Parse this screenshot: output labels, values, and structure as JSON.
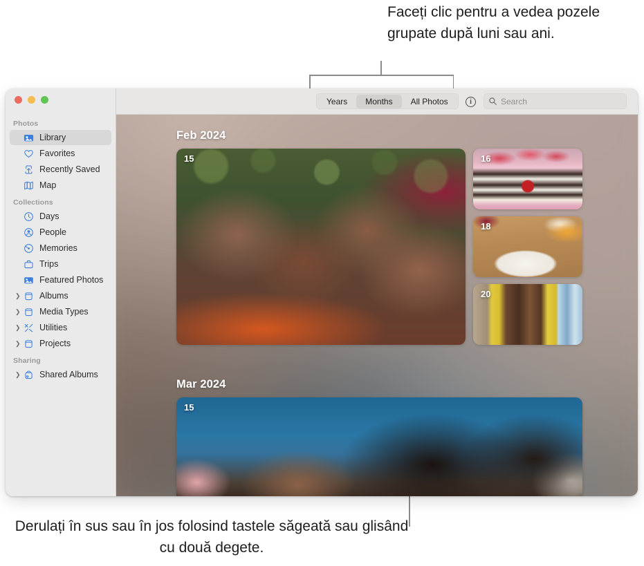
{
  "annotations": {
    "top_callout": "Faceți clic pentru a vedea pozele grupate după luni sau ani.",
    "bottom_callout": "Derulați în sus sau în jos folosind tastele săgeată sau glisând cu două degete."
  },
  "window": {
    "traffic_lights": [
      "close",
      "minimize",
      "zoom"
    ]
  },
  "sidebar": {
    "sections": [
      {
        "header": "Photos",
        "items": [
          {
            "label": "Library",
            "icon": "photos-library-icon",
            "selected": true,
            "disclosure": false
          },
          {
            "label": "Favorites",
            "icon": "heart-icon",
            "selected": false,
            "disclosure": false
          },
          {
            "label": "Recently Saved",
            "icon": "recently-saved-icon",
            "selected": false,
            "disclosure": false
          },
          {
            "label": "Map",
            "icon": "map-icon",
            "selected": false,
            "disclosure": false
          }
        ]
      },
      {
        "header": "Collections",
        "items": [
          {
            "label": "Days",
            "icon": "clock-icon",
            "selected": false,
            "disclosure": false
          },
          {
            "label": "People",
            "icon": "person-circle-icon",
            "selected": false,
            "disclosure": false
          },
          {
            "label": "Memories",
            "icon": "memories-icon",
            "selected": false,
            "disclosure": false
          },
          {
            "label": "Trips",
            "icon": "suitcase-icon",
            "selected": false,
            "disclosure": false
          },
          {
            "label": "Featured Photos",
            "icon": "featured-photo-icon",
            "selected": false,
            "disclosure": false
          },
          {
            "label": "Albums",
            "icon": "album-box-icon",
            "selected": false,
            "disclosure": true
          },
          {
            "label": "Media Types",
            "icon": "album-box-icon",
            "selected": false,
            "disclosure": true
          },
          {
            "label": "Utilities",
            "icon": "tools-icon",
            "selected": false,
            "disclosure": true
          },
          {
            "label": "Projects",
            "icon": "album-box-icon",
            "selected": false,
            "disclosure": true
          }
        ]
      },
      {
        "header": "Sharing",
        "items": [
          {
            "label": "Shared Albums",
            "icon": "shared-album-icon",
            "selected": false,
            "disclosure": true
          }
        ]
      }
    ]
  },
  "toolbar": {
    "segments": [
      {
        "label": "Years",
        "active": false
      },
      {
        "label": "Months",
        "active": true
      },
      {
        "label": "All Photos",
        "active": false
      }
    ],
    "info_button": "i",
    "search": {
      "placeholder": "Search",
      "value": ""
    }
  },
  "photo_grid": {
    "sections": [
      {
        "title": "Feb 2024",
        "photos": [
          {
            "badge": "15",
            "name": "photo-feb-main"
          },
          {
            "badge": "16",
            "name": "photo-feb-1"
          },
          {
            "badge": "18",
            "name": "photo-feb-2"
          },
          {
            "badge": "20",
            "name": "photo-feb-3"
          }
        ]
      },
      {
        "title": "Mar 2024",
        "photos": [
          {
            "badge": "15",
            "name": "photo-mar-main"
          }
        ]
      }
    ]
  },
  "colors": {
    "accent": "#3b7fe0",
    "sidebar_bg": "#eaeaea",
    "selected_row": "#d8d8d8",
    "toolbar_bg": "#e7e6e4",
    "callout_line": "#8b8b8b"
  }
}
